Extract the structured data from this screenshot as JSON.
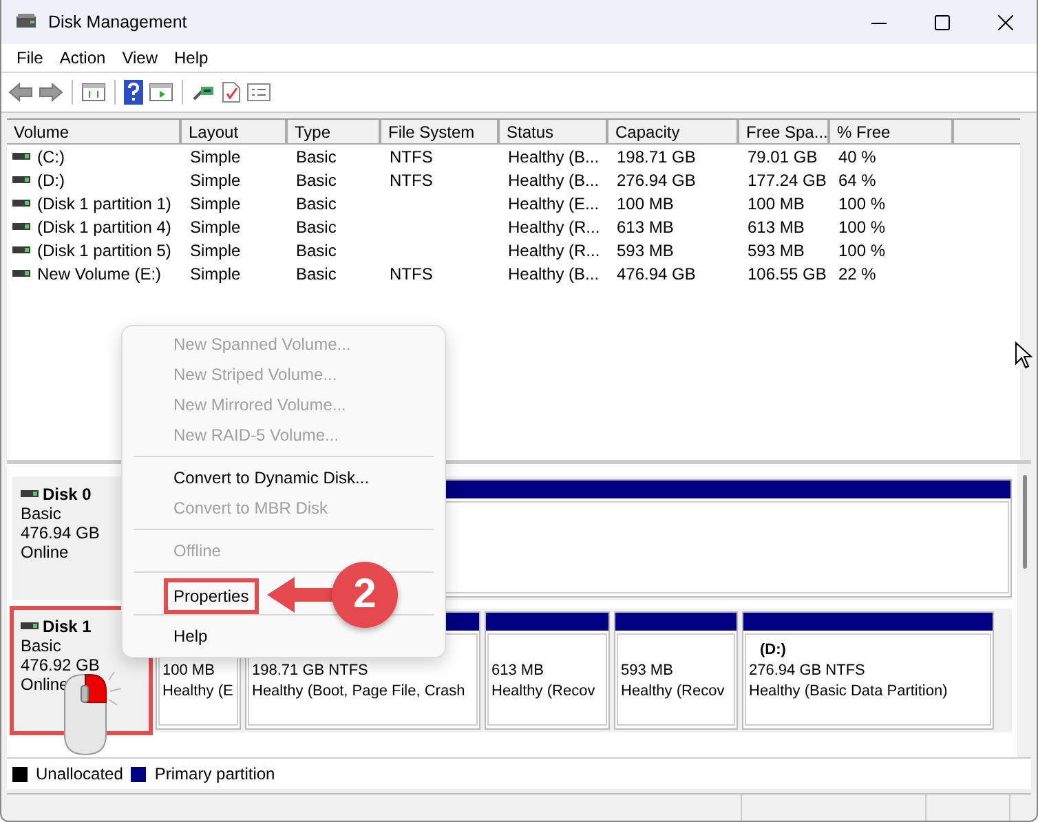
{
  "window": {
    "title": "Disk Management"
  },
  "menu": [
    "File",
    "Action",
    "View",
    "Help"
  ],
  "table": {
    "columns": [
      "Volume",
      "Layout",
      "Type",
      "File System",
      "Status",
      "Capacity",
      "Free Spa...",
      "% Free"
    ],
    "rows": [
      [
        "(C:)",
        "Simple",
        "Basic",
        "NTFS",
        "Healthy (B...",
        "198.71 GB",
        "79.01 GB",
        "40 %"
      ],
      [
        "(D:)",
        "Simple",
        "Basic",
        "NTFS",
        "Healthy (B...",
        "276.94 GB",
        "177.24 GB",
        "64 %"
      ],
      [
        "(Disk 1 partition 1)",
        "Simple",
        "Basic",
        "",
        "Healthy (E...",
        "100 MB",
        "100 MB",
        "100 %"
      ],
      [
        "(Disk 1 partition 4)",
        "Simple",
        "Basic",
        "",
        "Healthy (R...",
        "613 MB",
        "613 MB",
        "100 %"
      ],
      [
        "(Disk 1 partition 5)",
        "Simple",
        "Basic",
        "",
        "Healthy (R...",
        "593 MB",
        "593 MB",
        "100 %"
      ],
      [
        "New Volume (E:)",
        "Simple",
        "Basic",
        "NTFS",
        "Healthy (B...",
        "476.94 GB",
        "106.55 GB",
        "22 %"
      ]
    ]
  },
  "disks": [
    {
      "name": "Disk 0",
      "type": "Basic",
      "size": "476.94 GB",
      "status": "Online",
      "highlighted": false
    },
    {
      "name": "Disk 1",
      "type": "Basic",
      "size": "476.92 GB",
      "status": "Online",
      "highlighted": true,
      "partitions": [
        {
          "size": "100 MB",
          "status": "Healthy (E"
        },
        {
          "size": "198.71 GB NTFS",
          "status": "Healthy (Boot, Page File, Crash"
        },
        {
          "size": "613 MB",
          "status": "Healthy (Recov"
        },
        {
          "size": "593 MB",
          "status": "Healthy (Recov"
        },
        {
          "label": "(D:)",
          "size": "276.94 GB NTFS",
          "status": "Healthy (Basic Data Partition)"
        }
      ]
    }
  ],
  "legend": [
    {
      "label": "Unallocated",
      "color": "#000000"
    },
    {
      "label": "Primary partition",
      "color": "#000080"
    }
  ],
  "context_menu": [
    {
      "kind": "item",
      "label": "New Spanned Volume...",
      "disabled": true,
      "highlighted": false
    },
    {
      "kind": "item",
      "label": "New Striped Volume...",
      "disabled": true,
      "highlighted": false
    },
    {
      "kind": "item",
      "label": "New Mirrored Volume...",
      "disabled": true,
      "highlighted": false
    },
    {
      "kind": "item",
      "label": "New RAID-5 Volume...",
      "disabled": true,
      "highlighted": false
    },
    {
      "kind": "separator"
    },
    {
      "kind": "item",
      "label": "Convert to Dynamic Disk...",
      "disabled": false,
      "highlighted": false
    },
    {
      "kind": "item",
      "label": "Convert to MBR Disk",
      "disabled": true,
      "highlighted": false
    },
    {
      "kind": "separator"
    },
    {
      "kind": "item",
      "label": "Offline",
      "disabled": true,
      "highlighted": false
    },
    {
      "kind": "separator"
    },
    {
      "kind": "item",
      "label": "Properties",
      "disabled": false,
      "highlighted": true
    },
    {
      "kind": "separator"
    },
    {
      "kind": "item",
      "label": "Help",
      "disabled": false,
      "highlighted": false
    }
  ],
  "callout": {
    "number": "2"
  }
}
